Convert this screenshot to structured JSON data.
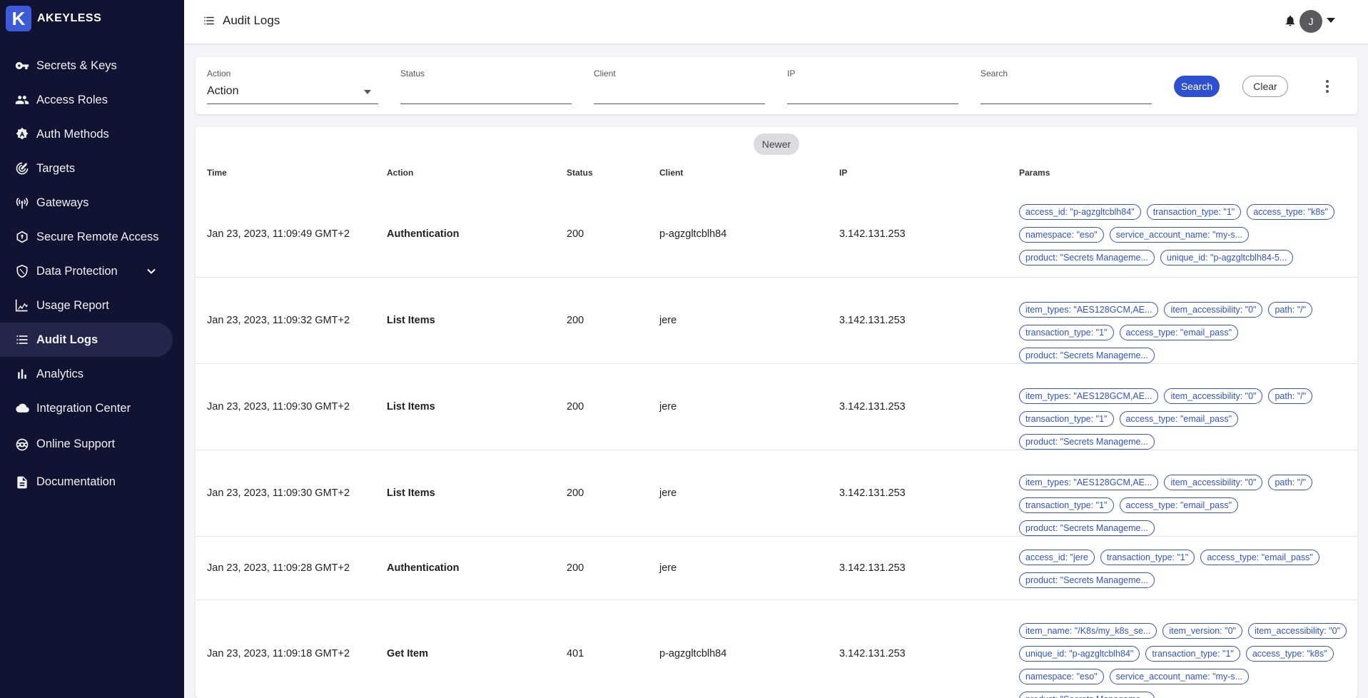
{
  "brand": {
    "logo_letter": "K",
    "name": "AKEYLESS"
  },
  "sidebar": {
    "items": [
      {
        "label": "Secrets & Keys",
        "icon": "key-icon"
      },
      {
        "label": "Access Roles",
        "icon": "people-icon"
      },
      {
        "label": "Auth Methods",
        "icon": "badge-icon"
      },
      {
        "label": "Targets",
        "icon": "target-icon"
      },
      {
        "label": "Gateways",
        "icon": "antenna-icon"
      },
      {
        "label": "Secure Remote Access",
        "icon": "hexagon-icon"
      },
      {
        "label": "Data Protection",
        "icon": "shield-icon"
      },
      {
        "label": "Usage Report",
        "icon": "chart-line-icon"
      },
      {
        "label": "Audit Logs",
        "icon": "list-icon"
      },
      {
        "label": "Analytics",
        "icon": "bar-chart-icon"
      },
      {
        "label": "Integration Center",
        "icon": "cloud-icon"
      },
      {
        "label": "Online Support",
        "icon": "support-icon"
      },
      {
        "label": "Documentation",
        "icon": "document-icon"
      }
    ]
  },
  "header": {
    "title": "Audit Logs",
    "avatar_initial": "J"
  },
  "filters": {
    "action": {
      "label": "Action",
      "value": "Action"
    },
    "status": {
      "label": "Status",
      "value": ""
    },
    "client": {
      "label": "Client",
      "value": ""
    },
    "ip": {
      "label": "IP",
      "value": ""
    },
    "search": {
      "label": "Search",
      "value": ""
    },
    "search_button": "Search",
    "clear_button": "Clear"
  },
  "table": {
    "newer_button": "Newer",
    "columns": {
      "time": "Time",
      "action": "Action",
      "status": "Status",
      "client": "Client",
      "ip": "IP",
      "params": "Params"
    },
    "rows": [
      {
        "time": "Jan 23, 2023, 11:09:49 GMT+2",
        "action": "Authentication",
        "status": "200",
        "client": "p-agzgltcblh84",
        "ip": "3.142.131.253",
        "params": [
          "access_id: \"p-agzgltcblh84\"",
          "transaction_type: \"1\"",
          "access_type: \"k8s\"",
          "namespace: \"eso\"",
          "service_account_name: \"my-s...",
          "product: \"Secrets Manageme...",
          "unique_id: \"p-agzgltcblh84-5..."
        ]
      },
      {
        "time": "Jan 23, 2023, 11:09:32 GMT+2",
        "action": "List Items",
        "status": "200",
        "client": "jere",
        "ip": "3.142.131.253",
        "params": [
          "item_types: \"AES128GCM,AE...",
          "item_accessibility: \"0\"",
          "path: \"/\"",
          "transaction_type: \"1\"",
          "access_type: \"email_pass\"",
          "product: \"Secrets Manageme..."
        ]
      },
      {
        "time": "Jan 23, 2023, 11:09:30 GMT+2",
        "action": "List Items",
        "status": "200",
        "client": "jere",
        "ip": "3.142.131.253",
        "params": [
          "item_types: \"AES128GCM,AE...",
          "item_accessibility: \"0\"",
          "path: \"/\"",
          "transaction_type: \"1\"",
          "access_type: \"email_pass\"",
          "product: \"Secrets Manageme..."
        ]
      },
      {
        "time": "Jan 23, 2023, 11:09:30 GMT+2",
        "action": "List Items",
        "status": "200",
        "client": "jere",
        "ip": "3.142.131.253",
        "params": [
          "item_types: \"AES128GCM,AE...",
          "item_accessibility: \"0\"",
          "path: \"/\"",
          "transaction_type: \"1\"",
          "access_type: \"email_pass\"",
          "product: \"Secrets Manageme..."
        ]
      },
      {
        "time": "Jan 23, 2023, 11:09:28 GMT+2",
        "action": "Authentication",
        "status": "200",
        "client": "jere",
        "ip": "3.142.131.253",
        "params": [
          "access_id: \"jere",
          "transaction_type: \"1\"",
          "access_type: \"email_pass\"",
          "product: \"Secrets Manageme..."
        ]
      },
      {
        "time": "Jan 23, 2023, 11:09:18 GMT+2",
        "action": "Get Item",
        "status": "401",
        "client": "p-agzgltcblh84",
        "ip": "3.142.131.253",
        "params": [
          "item_name: \"/K8s/my_k8s_se...",
          "item_version: \"0\"",
          "item_accessibility: \"0\"",
          "unique_id: \"p-agzgltcblh84\"",
          "transaction_type: \"1\"",
          "access_type: \"k8s\"",
          "namespace: \"eso\"",
          "service_account_name: \"my-s...",
          "product: \"Secrets Manageme..."
        ]
      }
    ]
  },
  "colors": {
    "sidebar_bg": "#121232",
    "accent": "#2f4fd1",
    "chip": "#3352d0"
  }
}
